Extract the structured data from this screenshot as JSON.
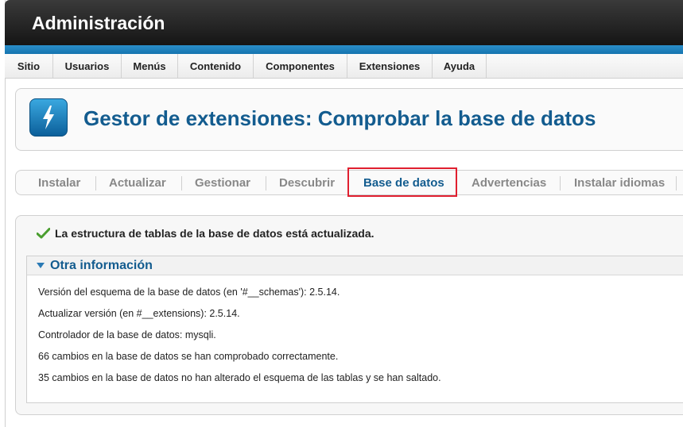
{
  "header": {
    "title": "Administración"
  },
  "menu": {
    "items": [
      "Sitio",
      "Usuarios",
      "Menús",
      "Contenido",
      "Componentes",
      "Extensiones",
      "Ayuda"
    ]
  },
  "page": {
    "title": "Gestor de extensiones: Comprobar la base de datos",
    "icon": "lightning-icon"
  },
  "subnav": {
    "items": [
      "Instalar",
      "Actualizar",
      "Gestionar",
      "Descubrir",
      "Base de datos",
      "Advertencias",
      "Instalar idiomas"
    ],
    "active": "Base de datos"
  },
  "status": {
    "message": "La estructura de tablas de la base de datos está actualizada.",
    "icon": "checkmark-icon",
    "color": "#4a9e2f"
  },
  "info": {
    "heading": "Otra información",
    "lines": [
      "Versión del esquema de la base de datos (en '#__schemas'): 2.5.14.",
      "Actualizar versión (en #__extensions): 2.5.14.",
      "Controlador de la base de datos: mysqli.",
      "66 cambios en la base de datos se han comprobado correctamente.",
      "35 cambios en la base de datos no han alterado el esquema de las tablas y se han saltado."
    ]
  },
  "colors": {
    "accent": "#135c8f",
    "highlight": "#e01f2f",
    "header_dark": "#1f1f1f",
    "strip_blue": "#1f84c0"
  }
}
